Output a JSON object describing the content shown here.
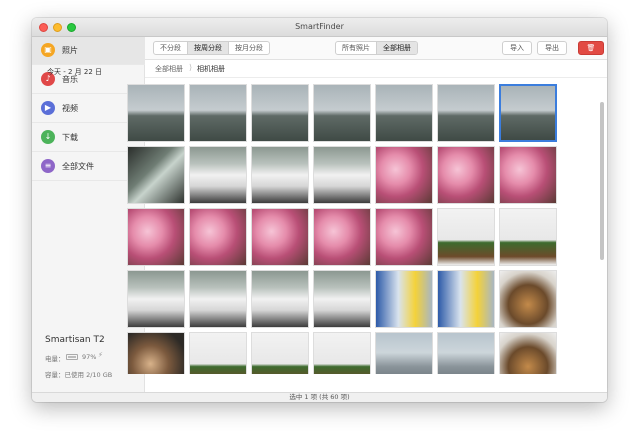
{
  "window": {
    "title": "SmartFinder"
  },
  "sidebar": {
    "items": [
      {
        "label": "照片",
        "icon": "photos-icon",
        "color": "#f5a623",
        "active": true
      },
      {
        "label": "音乐",
        "icon": "music-icon",
        "color": "#e04848"
      },
      {
        "label": "视频",
        "icon": "video-icon",
        "color": "#5b6fd8"
      },
      {
        "label": "下载",
        "icon": "download-icon",
        "color": "#4cb35a"
      },
      {
        "label": "全部文件",
        "icon": "files-icon",
        "color": "#8e66c8"
      }
    ],
    "device": {
      "name": "Smartisan T2",
      "battery_label": "电量：",
      "battery_value": "97%",
      "storage_label": "容量：已使用 2/10 GB"
    }
  },
  "toolbar": {
    "group_by": [
      "不分段",
      "按周分段",
      "按月分段"
    ],
    "group_by_selected": "按周分段",
    "scope": [
      "所有照片",
      "全部相册"
    ],
    "scope_selected": "全部相册",
    "import_label": "导入",
    "export_label": "导出",
    "delete_icon": "trash-icon",
    "delete_color": "#e24a43"
  },
  "breadcrumb": [
    "全部相册",
    "相机相册"
  ],
  "section_date": "今天 - 2 月 22 日",
  "thumbnails": [
    "city-skyline",
    "city-skyline",
    "city-skyline",
    "city-skyline",
    "city-skyline",
    "city-skyline",
    "city-skyline",
    "car-interior",
    "white-car",
    "white-car",
    "white-car",
    "cherry-blossom",
    "cherry-blossom",
    "cherry-blossom",
    "cherry-blossom",
    "cherry-blossom",
    "cherry-blossom",
    "cherry-blossom",
    "cherry-blossom",
    "toy-figures",
    "toy-figures",
    "white-car",
    "white-car",
    "white-car",
    "white-car",
    "shop-front",
    "shop-front",
    "cat",
    "dog",
    "toy-figures",
    "toy-figures",
    "toy-figures",
    "buildings",
    "buildings",
    "cat"
  ],
  "selected_index": 6,
  "status": "选中 1 项 (共 60 项)",
  "colors": {
    "accent": "#3b7ddd",
    "selection": "#3b7ddd"
  }
}
